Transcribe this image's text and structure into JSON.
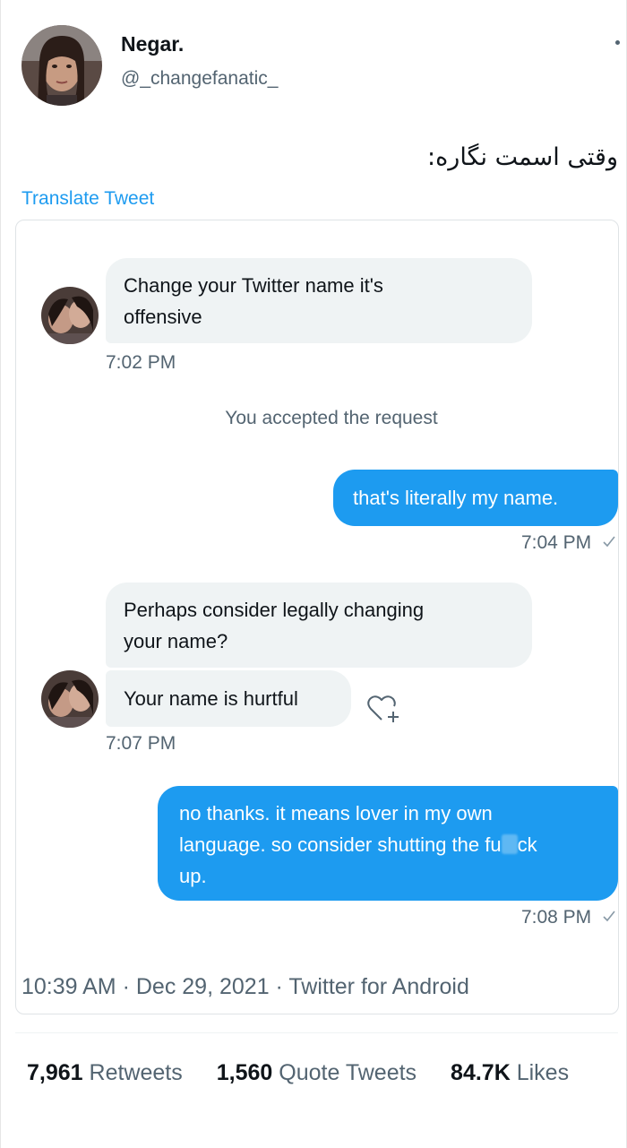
{
  "tweet": {
    "author": {
      "name": "Negar.",
      "handle": "@_changefanatic_"
    },
    "text": "وقتی اسمت نگاره:",
    "translate_label": "Translate Tweet",
    "meta": {
      "time": "10:39 AM",
      "date": "Dec 29, 2021",
      "source": "Twitter for Android",
      "separator": "·"
    },
    "stats": {
      "retweets": {
        "count": "7,961",
        "label": "Retweets"
      },
      "quote_tweets": {
        "count": "1,560",
        "label": "Quote Tweets"
      },
      "likes": {
        "count": "84.7K",
        "label": "Likes"
      }
    }
  },
  "conversation": {
    "m1": {
      "text_line1": "Change your Twitter name it's",
      "text_line2": "offensive",
      "time": "7:02 PM"
    },
    "system": "You accepted the request",
    "m2": {
      "text": "that's literally my name.",
      "time": "7:04 PM"
    },
    "m3": {
      "text_line1": "Perhaps consider legally changing",
      "text_line2": "your name?"
    },
    "m4": {
      "text": "Your name is hurtful",
      "time": "7:07 PM"
    },
    "m5": {
      "text_line1": "no thanks. it means lover in my own",
      "text_line2": "language. so consider shutting the fu",
      "text_censored": "ck",
      "text_line3": "up.",
      "time": "7:08 PM"
    }
  },
  "colors": {
    "accent": "#1d9bf0",
    "incoming_bubble": "#eff3f4",
    "muted_text": "#536471"
  },
  "icons": {
    "more": "more-dot-icon",
    "react": "add-reaction-icon",
    "check": "sent-check-icon"
  }
}
